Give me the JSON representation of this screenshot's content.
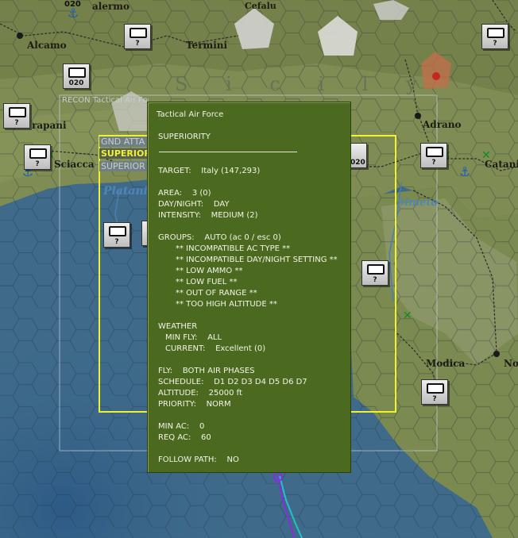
{
  "map": {
    "towns": [
      "Palermo",
      "Cefalu",
      "Alcamo",
      "Termini",
      "Trapani",
      "Sciacca",
      "Adrano",
      "Catania",
      "Modica",
      "Noto"
    ],
    "towns_visible": [
      "alermo",
      "Cefalu",
      "Alcamo",
      "Termini",
      "rapani",
      "Sciacca",
      "Adrano",
      "Catani",
      "Modica",
      "No"
    ],
    "regions": [
      "Platani",
      "Simeto"
    ],
    "island_label": "Sicily",
    "island_label_visible": "S  i  c  i  l  y"
  },
  "counters": [
    {
      "id": "c1",
      "label": "?"
    },
    {
      "id": "c2",
      "label": "020"
    },
    {
      "id": "c3",
      "label": "?"
    },
    {
      "id": "c4",
      "label": "?"
    },
    {
      "id": "c5",
      "label": "?"
    },
    {
      "id": "c6",
      "label": "?"
    },
    {
      "id": "c7",
      "label": "?"
    },
    {
      "id": "c8",
      "label": "?"
    },
    {
      "id": "c9",
      "label": "?"
    },
    {
      "id": "c10",
      "label": "?"
    },
    {
      "id": "c11",
      "label": "020"
    }
  ],
  "top_counter_label": "020",
  "mission_stack": {
    "recon": "RECON  Tactical Air Force",
    "gnd_attack": "GND ATTA",
    "superiority_selected": "SUPERIOR",
    "superiority_2": "SUPERIOR"
  },
  "popup": {
    "title": "Tactical Air Force",
    "mission": "SUPERIORITY",
    "target": "TARGET:    Italy (147,293)",
    "area": "AREA:    3 (0)",
    "day_night": "DAY/NIGHT:    DAY",
    "intensity": "INTENSITY:    MEDIUM (2)",
    "groups": "GROUPS:    AUTO (ac 0 / esc 0)",
    "warnings": [
      "** INCOMPATIBLE AC TYPE **",
      "** INCOMPATIBLE DAY/NIGHT SETTING **",
      "** LOW AMMO **",
      "** LOW FUEL **",
      "** OUT OF RANGE **",
      "** TOO HIGH ALTITUDE **"
    ],
    "weather": "WEATHER",
    "min_fly": "MIN FLY:    ALL",
    "current": "CURRENT:    Excellent (0)",
    "fly": "FLY:    BOTH AIR PHASES",
    "schedule": "SCHEDULE:    D1 D2 D3 D4 D5 D6 D7",
    "altitude": "ALTITUDE:    25000 ft",
    "priority": "PRIORITY:    NORM",
    "min_ac": "MIN AC:    0",
    "req_ac": "REQ AC:    60",
    "follow_path": "FOLLOW PATH:    NO"
  },
  "colors": {
    "sea": "#3f6a8a",
    "land": "#7f8c53",
    "popup_bg": "#4c6a1f",
    "area_box": "#f2f22a",
    "selected_text": "#f4f424",
    "route_purple": "#8a2be2",
    "route_cyan": "#22c3c3"
  }
}
